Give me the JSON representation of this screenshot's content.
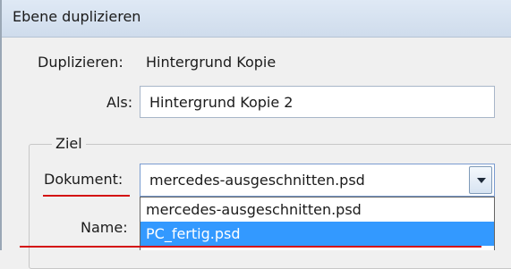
{
  "dialog": {
    "title": "Ebene duplizieren"
  },
  "duplicate": {
    "label": "Duplizieren:",
    "value": "Hintergrund Kopie"
  },
  "as": {
    "label": "Als:",
    "value": "Hintergrund Kopie 2"
  },
  "target": {
    "legend": "Ziel",
    "document_label": "Dokument:",
    "document_value": "mercedes-ausgeschnitten.psd",
    "name_label": "Name:",
    "options": [
      {
        "label": "mercedes-ausgeschnitten.psd",
        "selected": false
      },
      {
        "label": "PC_fertig.psd",
        "selected": true
      }
    ]
  },
  "colors": {
    "selection": "#3399ff",
    "annotation_red": "#d41111"
  }
}
